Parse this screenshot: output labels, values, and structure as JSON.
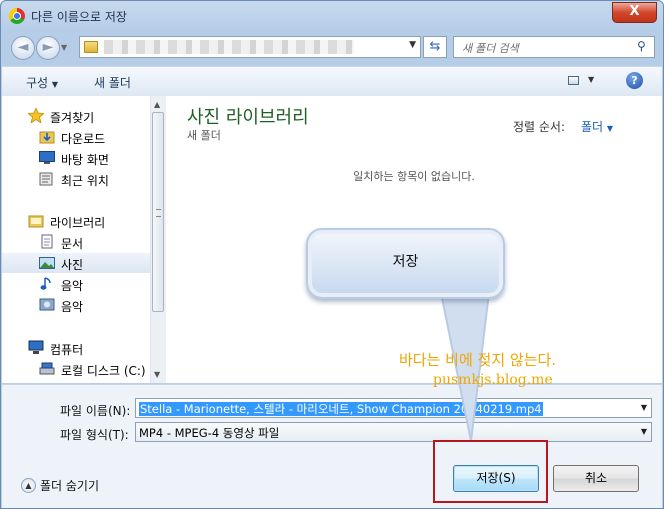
{
  "window": {
    "title": "다른 이름으로 저장",
    "close_label": "X"
  },
  "nav": {
    "back_label": "◄",
    "forward_label": "►",
    "search_placeholder": "새 폴더 검색"
  },
  "toolbar": {
    "organize_label": "구성",
    "new_folder_label": "새 폴더",
    "help_label": "?"
  },
  "sidebar": {
    "items": [
      {
        "label": "즐겨찾기",
        "icon": "star-icon",
        "type": "group"
      },
      {
        "label": "다운로드",
        "icon": "downloads-folder-icon",
        "type": "child"
      },
      {
        "label": "바탕 화면",
        "icon": "desktop-icon",
        "type": "child"
      },
      {
        "label": "최근 위치",
        "icon": "recent-places-icon",
        "type": "child"
      },
      {
        "label": "라이브러리",
        "icon": "library-icon",
        "type": "group"
      },
      {
        "label": "문서",
        "icon": "documents-icon",
        "type": "child"
      },
      {
        "label": "사진",
        "icon": "pictures-icon",
        "type": "child",
        "selected": true
      },
      {
        "label": "음악",
        "icon": "music-icon",
        "type": "child"
      },
      {
        "label": "음악",
        "icon": "music-icon",
        "type": "child"
      },
      {
        "label": "컴퓨터",
        "icon": "computer-icon",
        "type": "group"
      },
      {
        "label": "로컬 디스크 (C:)",
        "icon": "local-disk-icon",
        "type": "child"
      }
    ]
  },
  "content": {
    "library_title": "사진 라이브러리",
    "library_subtitle": "새 폴더",
    "sort_label": "정렬 순서:",
    "sort_value": "폴더",
    "empty_message": "일치하는 항목이 없습니다."
  },
  "callout": {
    "text": "저장"
  },
  "annotation": {
    "note": "바다는 비에 젖지 않는다.",
    "blog": "pusmkjs.blog.me"
  },
  "form": {
    "filename_label": "파일 이름(N):",
    "filename_value": "Stella - Marionette, 스텔라 - 마리오네트, Show Champion 20140219.mp4",
    "filetype_label": "파일 형식(T):",
    "filetype_value": "MP4 - MPEG-4 동영상 파일",
    "hide_folders_label": "폴더 숨기기",
    "save_label": "저장(S)",
    "cancel_label": "취소"
  },
  "colors": {
    "accent": "#1c5fb8",
    "library_title": "#1f5f25",
    "annotation": "#f0a500",
    "highlight_box": "#b4181c"
  }
}
